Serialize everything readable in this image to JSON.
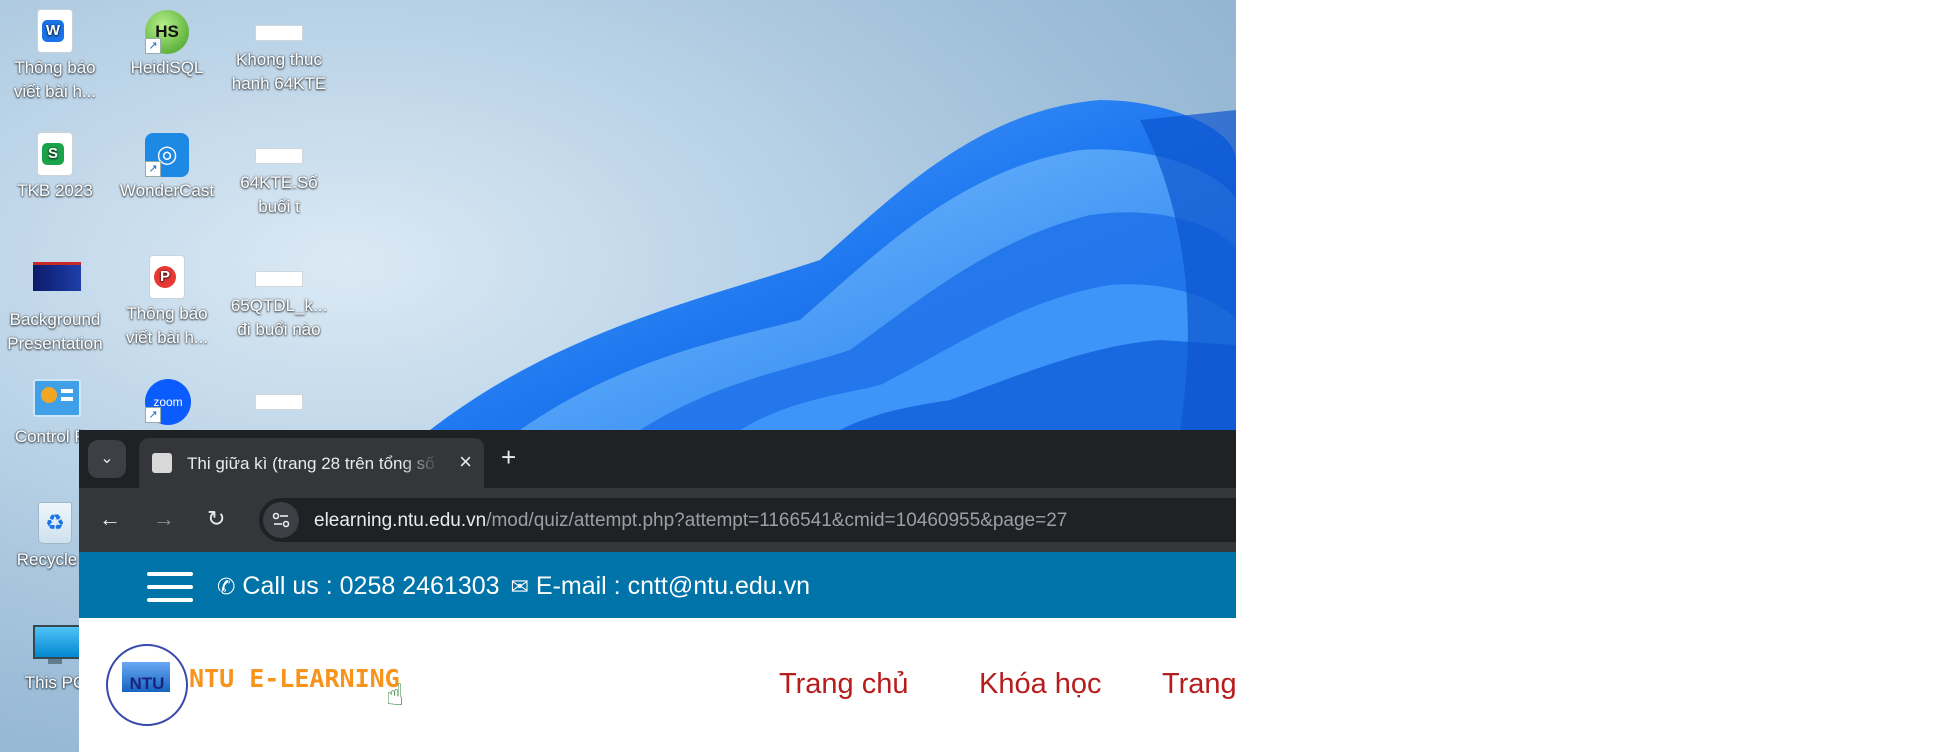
{
  "desktop": {
    "icons": [
      {
        "label": "Thông báo\nviết bài h...",
        "kind": "word-doc"
      },
      {
        "label": "HeidiSQL",
        "kind": "heidisql-app"
      },
      {
        "label": "Khong thuc\nhanh 64KTE",
        "kind": "file"
      },
      {
        "label": "TKB 2023",
        "kind": "spreadsheet"
      },
      {
        "label": "WonderCast",
        "kind": "wondercast-app"
      },
      {
        "label": "64KTE.Số\nbuổi t",
        "kind": "file"
      },
      {
        "label": "Background\nPresentation",
        "kind": "image"
      },
      {
        "label": "Thông báo\nviết bài h...",
        "kind": "pdf"
      },
      {
        "label": "65QTDL_k...\nđi buổi nào",
        "kind": "file"
      },
      {
        "label": "Control Pa",
        "kind": "control-panel"
      },
      {
        "label": "",
        "kind": "zoom-app"
      },
      {
        "label": "",
        "kind": "file"
      },
      {
        "label": "Recycle B",
        "kind": "recycle-bin"
      },
      {
        "label": "This PC",
        "kind": "this-pc"
      }
    ]
  },
  "browser": {
    "tab_title": "Thi giữa kì (trang 28 trên tổng số",
    "url_host": "elearning.ntu.edu.vn",
    "url_path": "/mod/quiz/attempt.php?attempt=1166541&cmid=10460955&page=27"
  },
  "page": {
    "contact": "Call us : 0258 2461303",
    "email": "E-mail : cntt@ntu.edu.vn",
    "logo_text": "NTU E-LEARNING",
    "logo_caption": "NTU",
    "nav": [
      "Trang chủ",
      "Khóa học",
      "Trang"
    ]
  },
  "colors": {
    "topbar": "#0073a8",
    "logo_orange": "#f7941d",
    "nav_red": "#b71c1c",
    "chrome_dark": "#35363a"
  }
}
